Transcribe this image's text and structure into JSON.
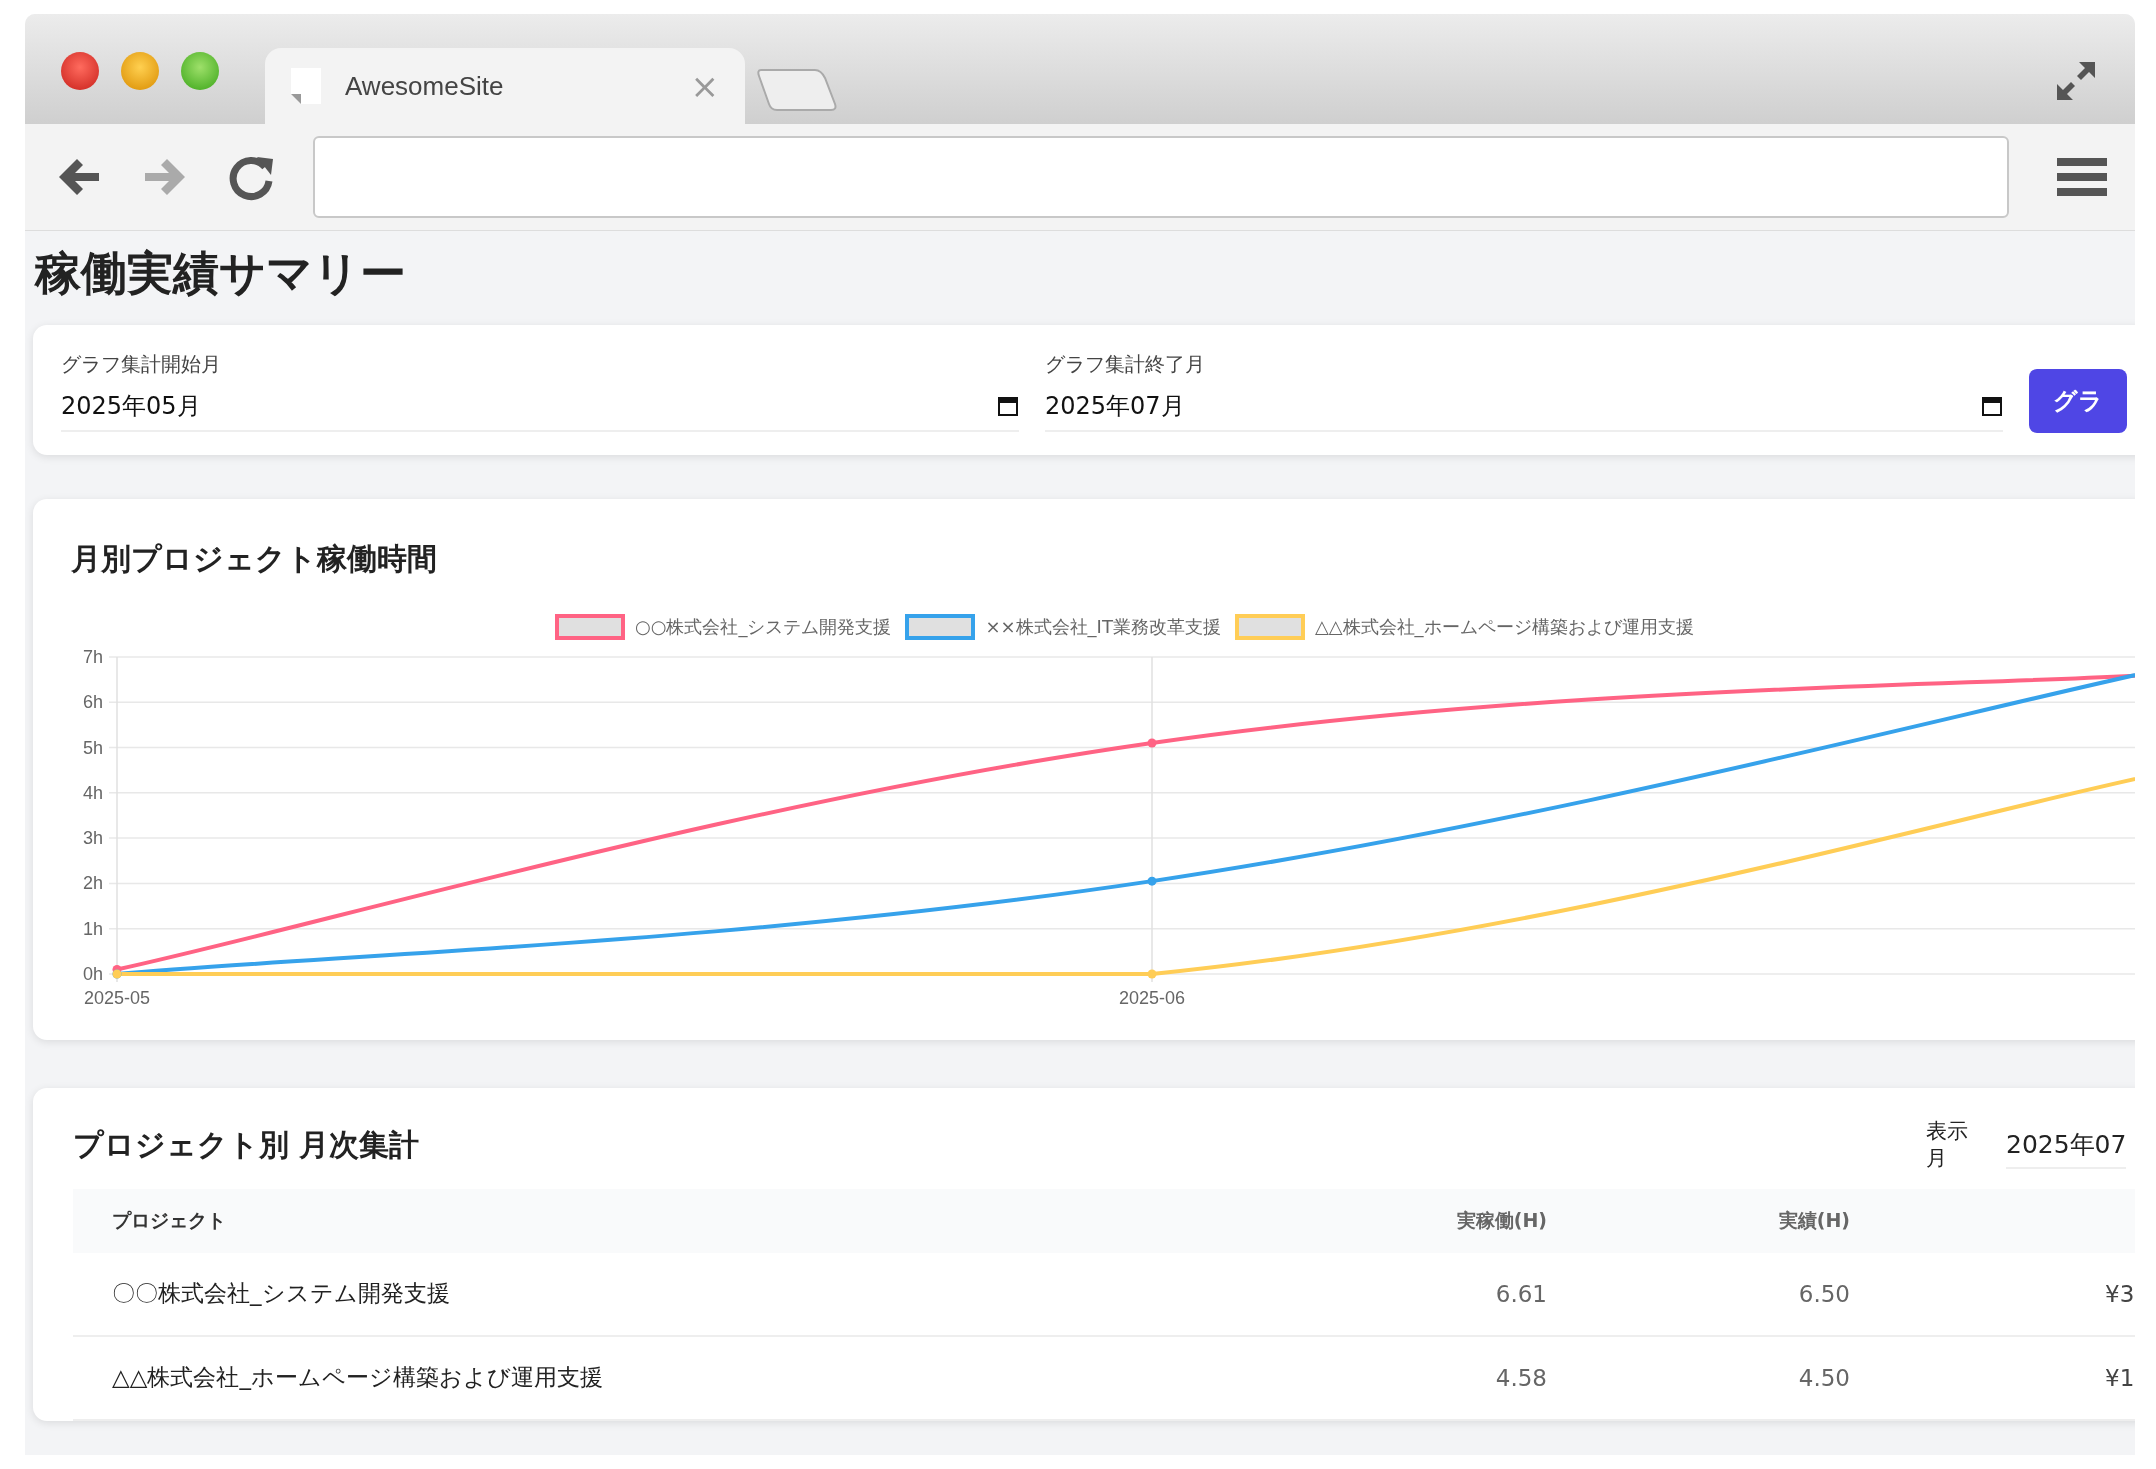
{
  "browser": {
    "tab": {
      "title": "AwesomeSite",
      "close": "×"
    }
  },
  "page_title": "稼働実績サマリー",
  "filters": [
    {
      "label": "グラフ集計開始月",
      "value": "2025年05月"
    },
    {
      "label": "グラフ集計終了月",
      "value": "2025年07月"
    }
  ],
  "filter_button": "グラ",
  "chart_card": {
    "title": "月別プロジェクト稼働時間",
    "chart_data": {
      "type": "line",
      "categories": [
        "2025-05",
        "2025-06",
        null
      ],
      "ylim": [
        0,
        7
      ],
      "grid": true,
      "yticks": [
        {
          "value": 0,
          "label": "0h"
        },
        {
          "value": 1,
          "label": "1h"
        },
        {
          "value": 2,
          "label": "2h"
        },
        {
          "value": 3,
          "label": "3h"
        },
        {
          "value": 4,
          "label": "4h"
        },
        {
          "value": 5,
          "label": "5h"
        },
        {
          "value": 6,
          "label": "6h"
        },
        {
          "value": 7,
          "label": "7h"
        }
      ],
      "series": [
        {
          "name": "○○株式会社_システム開発支援",
          "color": "#ff6384",
          "values": [
            0.1,
            5.1,
            6.65
          ]
        },
        {
          "name": "××株式会社_IT業務改革支援",
          "color": "#36a2eb",
          "values": [
            0,
            2.05,
            6.85
          ]
        },
        {
          "name": "△△株式会社_ホームページ構築および運用支援",
          "color": "#ffcd56",
          "values": [
            0,
            0,
            4.55
          ]
        }
      ]
    }
  },
  "table_card": {
    "title": "プロジェクト別 月次集計",
    "month_label": "表示月",
    "month_value": "2025年07",
    "columns": [
      "プロジェクト",
      "実稼働(H)",
      "実績(H)"
    ],
    "rows": [
      [
        "〇〇株式会社_システム開発支援",
        "6.61",
        "6.50",
        "¥3"
      ],
      [
        "△△株式会社_ホームページ構築および運用支援",
        "4.58",
        "4.50",
        "¥1"
      ]
    ]
  }
}
